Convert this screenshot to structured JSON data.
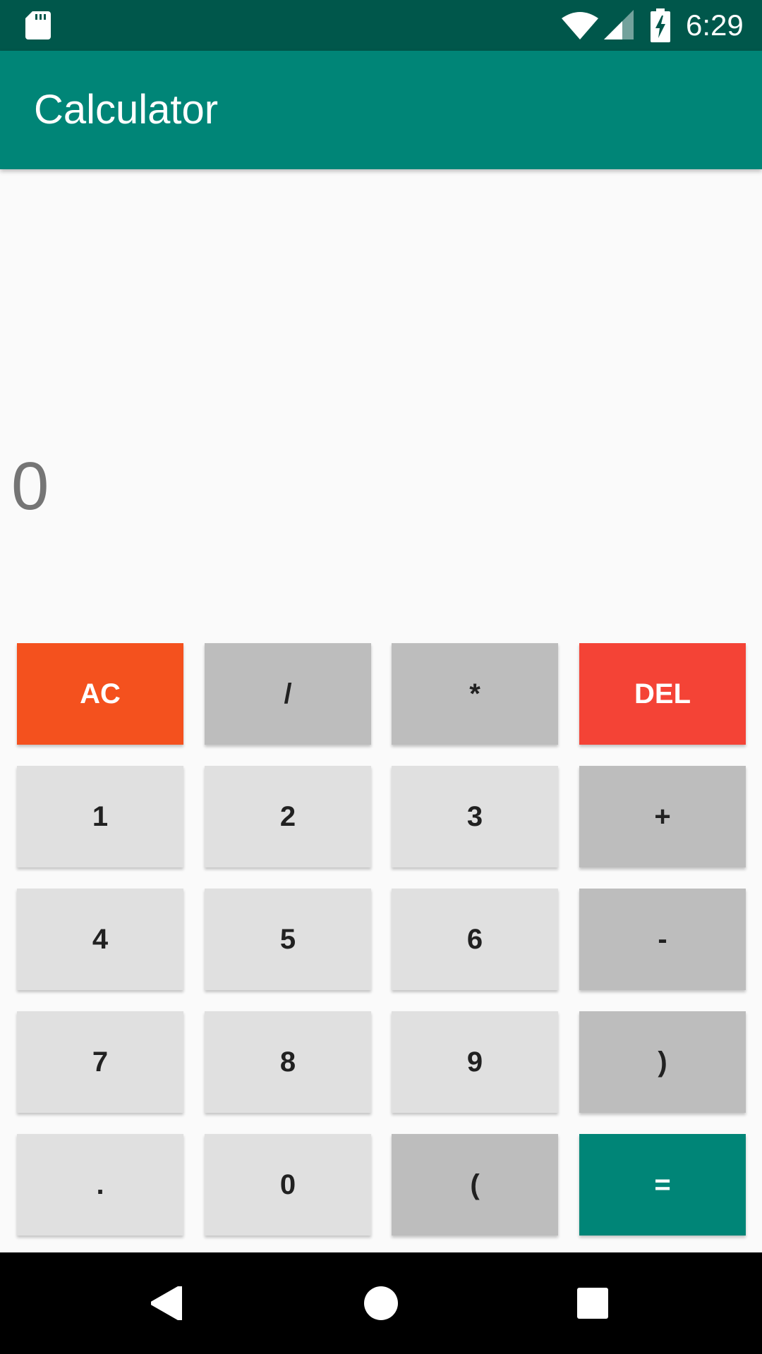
{
  "status_bar": {
    "time": "6:29",
    "icons": [
      "sd-card-icon",
      "wifi-icon",
      "signal-icon",
      "battery-charging-icon"
    ]
  },
  "app_bar": {
    "title": "Calculator"
  },
  "display": {
    "value": "0"
  },
  "keypad": {
    "rows": [
      [
        "AC",
        "/",
        "*",
        "DEL"
      ],
      [
        "1",
        "2",
        "3",
        "+"
      ],
      [
        "4",
        "5",
        "6",
        "-"
      ],
      [
        "7",
        "8",
        "9",
        ")"
      ],
      [
        ".",
        "0",
        "(",
        "="
      ]
    ]
  },
  "nav_bar": {
    "icons": [
      "back-icon",
      "home-icon",
      "recents-icon"
    ]
  },
  "colors": {
    "status_bar": "#00574b",
    "primary": "#008577",
    "clear_key": "#f4511e",
    "delete_key": "#f44336",
    "digit_key": "#e0e0e0",
    "operator_key": "#bdbdbd",
    "display_text": "#757575"
  }
}
